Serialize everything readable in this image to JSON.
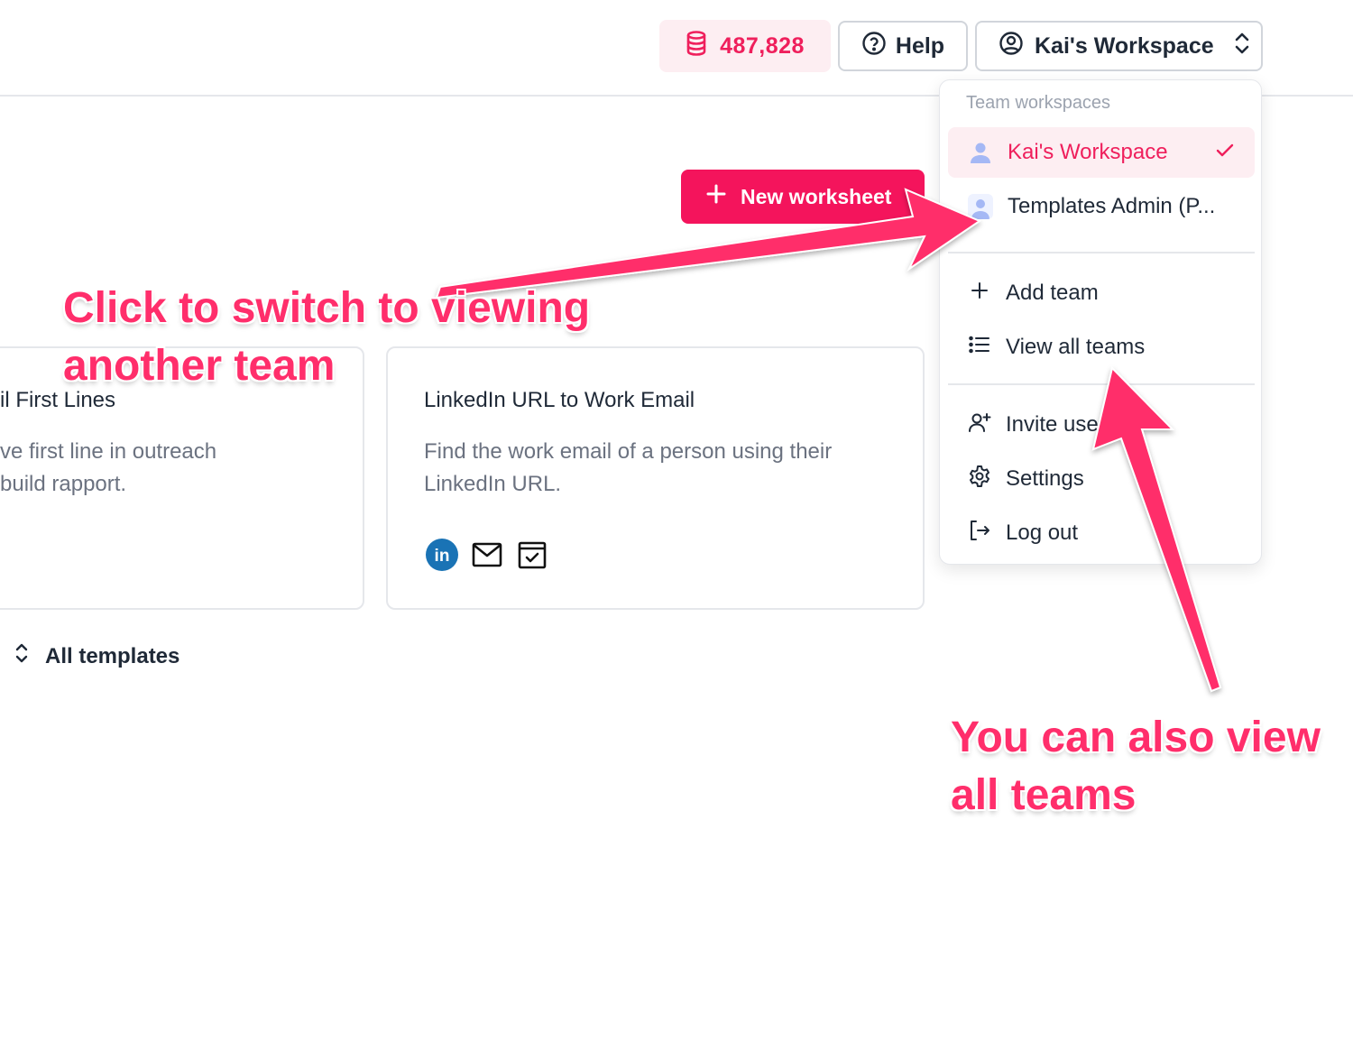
{
  "header": {
    "credits": "487,828",
    "help_label": "Help",
    "workspace_label": "Kai's Workspace"
  },
  "actions": {
    "new_worksheet_label": "New worksheet"
  },
  "cards": [
    {
      "title": "il First Lines",
      "description_line1": "ve first line in outreach",
      "description_line2": "build rapport."
    },
    {
      "title": "LinkedIn URL to Work Email",
      "description_line1": "Find the work email of a person using their",
      "description_line2": "LinkedIn URL.",
      "icons": [
        "linkedin-icon",
        "mail-icon",
        "calendar-check-icon"
      ]
    }
  ],
  "footer": {
    "all_templates_label": "All templates"
  },
  "menu": {
    "section_label": "Team workspaces",
    "workspaces": [
      {
        "label": "Kai's Workspace",
        "selected": true
      },
      {
        "label": "Templates Admin (P...",
        "selected": false
      }
    ],
    "team_actions": [
      {
        "label": "Add team",
        "icon": "plus-icon"
      },
      {
        "label": "View all teams",
        "icon": "list-icon"
      }
    ],
    "account_actions": [
      {
        "label": "Invite use",
        "icon": "user-plus-icon"
      },
      {
        "label": "Settings",
        "icon": "gear-icon"
      },
      {
        "label": "Log out",
        "icon": "logout-icon"
      }
    ]
  },
  "annotations": {
    "switch_team_line1": "Click to switch to viewing",
    "switch_team_line2": "another team",
    "view_all_line1": "You can also view",
    "view_all_line2": "all teams"
  },
  "colors": {
    "brand": "#f4145c",
    "annotation": "#ff2e6b",
    "credits_bg": "#fdeef2"
  }
}
